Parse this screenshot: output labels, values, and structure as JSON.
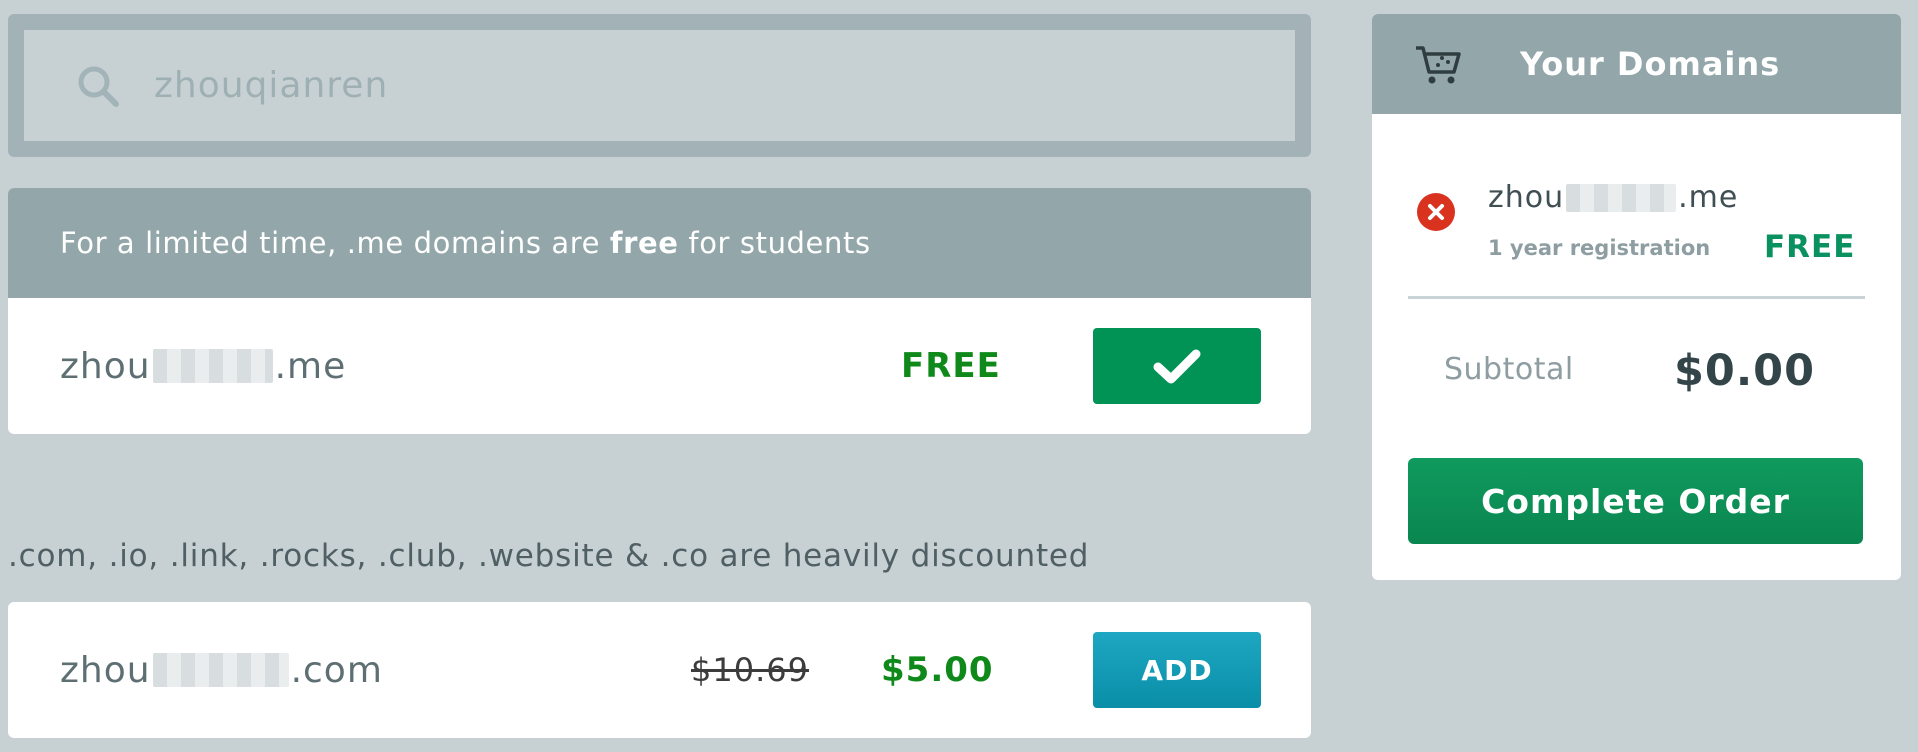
{
  "search": {
    "value": "zhouqianren"
  },
  "promo": {
    "banner_pre": "For a limited time, .me domains are ",
    "banner_bold": "free",
    "banner_post": " for students",
    "domain_prefix": "zhou",
    "domain_suffix": ".me",
    "price_label": "FREE"
  },
  "discount": {
    "text": ".com, .io, .link, .rocks, .club, .website & .co are heavily discounted",
    "domain_prefix": "zhou",
    "domain_suffix": ".com",
    "old_price": "$10.69",
    "new_price": "$5.00",
    "add_label": "ADD"
  },
  "cart": {
    "title": "Your Domains",
    "item": {
      "domain_prefix": "zhou",
      "domain_suffix": ".me",
      "term": "1 year registration",
      "price": "FREE"
    },
    "subtotal_label": "Subtotal",
    "subtotal_value": "$0.00",
    "complete_label": "Complete Order"
  },
  "colors": {
    "background": "#c7d1d4",
    "banner": "#93a6a9",
    "green_button": "#009355",
    "add_button": "#0a8ea8",
    "price_green": "#0f8a1a"
  }
}
